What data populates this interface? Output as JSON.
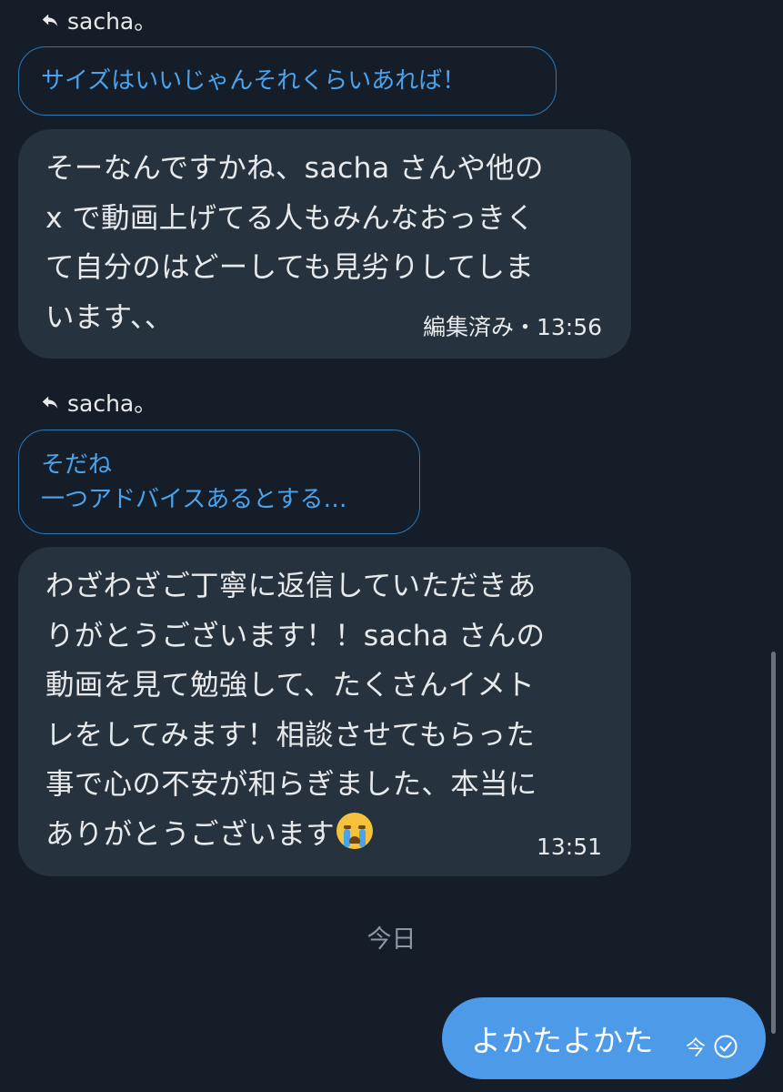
{
  "messages": [
    {
      "reply_to": {
        "name": "sacha。",
        "quote": "サイズはいいじゃんそれくらいあれば！"
      },
      "lines": [
        "そーなんですかね、sacha さんや他の",
        "x で動画上げてる人もみんなおっきく",
        "て自分のはどーしても見劣りしてしま",
        "います、、"
      ],
      "meta": "編集済み・13:56"
    },
    {
      "reply_to": {
        "name": "sacha。",
        "quote_lines": [
          "そだね",
          "一つアドバイスあるとする…"
        ]
      },
      "lines": [
        "わざわざご丁寧に返信していただきあ",
        "りがとうございます！！sacha さんの",
        "動画を見て勉強して、たくさんイメト",
        "レをしてみます！相談させてもらった",
        "事で心の不安が和らぎました、本当に",
        "ありがとうございます"
      ],
      "emoji": "loudly-crying-face-emoji",
      "meta": "13:51"
    }
  ],
  "date_separator": "今日",
  "outgoing": {
    "text": "よかたよかた",
    "time": "今",
    "status_icon": "sent-check-icon"
  },
  "colors": {
    "background": "#151d28",
    "incoming_bubble": "#27323f",
    "outgoing_bubble": "#4c9ae8",
    "quote_border": "#2c77b5",
    "quote_text": "#4aa3ec",
    "secondary_text": "#8b98a5"
  }
}
